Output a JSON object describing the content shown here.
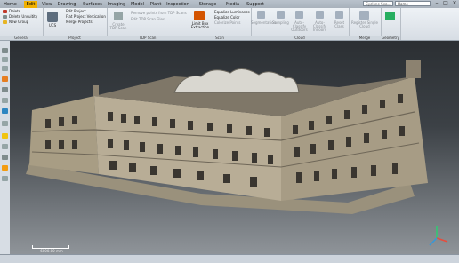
{
  "title_tabs": [
    "Home",
    "Edit",
    "View",
    "Drawing",
    "Surfaces",
    "Imaging",
    "Model",
    "Plant",
    "Inspection",
    "Storage Tank",
    "Media",
    "Support"
  ],
  "active_tab": "Edit",
  "search": {
    "box_text": "Cyclone Sea…",
    "select_text": "Home"
  },
  "window_buttons": [
    "–",
    "□",
    "×"
  ],
  "ribbon": {
    "general": {
      "label": "General",
      "items": [
        "Delete",
        "Delete Unsuitity",
        "New Group"
      ]
    },
    "project": {
      "label": "Project",
      "ucs": "UCS",
      "items": [
        "Edit Project",
        "Flat Project Vertical on",
        "Merge Projects"
      ]
    },
    "tdp_scan": {
      "label": "TDP Scan",
      "create": "Create TDP Scan",
      "items": [
        "Remove points from TDP Scans",
        "Edit TDP Scan Files"
      ]
    },
    "scan": {
      "label": "Scan",
      "limit_box": "Limit Box Extraction",
      "items": [
        "Equalize Luminance",
        "Equalize Color",
        "Colorize Points"
      ]
    },
    "cloud": {
      "label": "Cloud",
      "buttons": [
        "Segmentation",
        "Sampling",
        "Auto-Classify Outdoors",
        "Auto-Classify Indoors",
        "Reset Class"
      ]
    },
    "merge": {
      "label": "Merge",
      "button": "Register Single Cloud"
    },
    "geometry": {
      "label": "Geometry"
    }
  },
  "viewport": {
    "scale_label": "6000.00 mm"
  },
  "colors": {
    "accent": "#f0b000",
    "ribbon_top": "#eef2f6",
    "viewport_bg": "#3c4146",
    "stone": "#b8ad96"
  }
}
